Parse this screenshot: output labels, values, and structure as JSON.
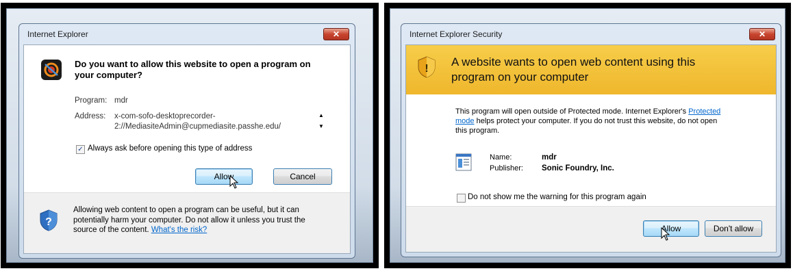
{
  "left_dialog": {
    "title": "Internet Explorer",
    "close_label": "✕",
    "heading": "Do you want to allow this website to open a program on your computer?",
    "program_label": "Program:",
    "program_value": "mdr",
    "address_label": "Address:",
    "address_line1": "x-com-sofo-desktoprecorder-",
    "address_line2": "2://MediasiteAdmin@cupmediasite.passhe.edu/",
    "checkbox_label": "Always ask before opening this type of address",
    "checkbox_checked": "✓",
    "allow_label": "Allow",
    "cancel_label": "Cancel",
    "footer_text": "Allowing web content to open a program can be useful, but it can potentially harm your computer. Do not allow it unless you trust the source of the content.",
    "footer_link": "What's the risk?"
  },
  "right_dialog": {
    "title": "Internet Explorer Security",
    "close_label": "✕",
    "banner_text": "A website wants to open web content using this program on your computer",
    "body_text_1": "This program will open outside of Protected mode. Internet Explorer's",
    "body_link": "Protected mode",
    "body_text_2": "helps protect your computer. If you do not trust this website, do not open this program.",
    "name_label": "Name:",
    "name_value": "mdr",
    "publisher_label": "Publisher:",
    "publisher_value": "Sonic Foundry, Inc.",
    "checkbox_label": "Do not show me the warning for this program again",
    "allow_label": "Allow",
    "dont_allow_label": "Don't allow"
  },
  "colors": {
    "banner": "#f4c33a",
    "link": "#0066cc"
  }
}
